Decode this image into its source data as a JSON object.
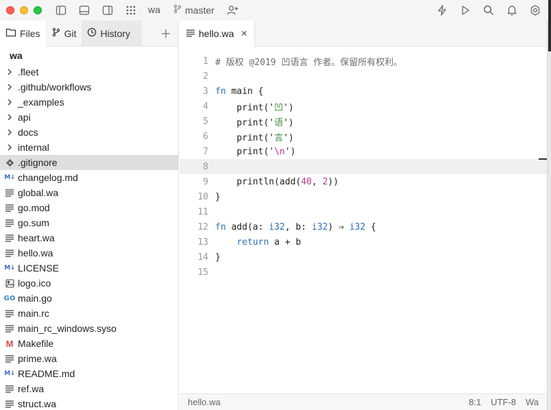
{
  "titlebar": {
    "project": "wa",
    "branch": "master"
  },
  "sidebar": {
    "tabs": [
      {
        "label": "Files"
      },
      {
        "label": "Git"
      },
      {
        "label": "History"
      }
    ],
    "root": "wa",
    "items": [
      {
        "label": ".fleet",
        "kind": "folder"
      },
      {
        "label": ".github/workflows",
        "kind": "folder"
      },
      {
        "label": "_examples",
        "kind": "folder"
      },
      {
        "label": "api",
        "kind": "folder"
      },
      {
        "label": "docs",
        "kind": "folder"
      },
      {
        "label": "internal",
        "kind": "folder"
      },
      {
        "label": ".gitignore",
        "kind": "git",
        "selected": true
      },
      {
        "label": "changelog.md",
        "kind": "md"
      },
      {
        "label": "global.wa",
        "kind": "text"
      },
      {
        "label": "go.mod",
        "kind": "text"
      },
      {
        "label": "go.sum",
        "kind": "text"
      },
      {
        "label": "heart.wa",
        "kind": "text"
      },
      {
        "label": "hello.wa",
        "kind": "text"
      },
      {
        "label": "LICENSE",
        "kind": "md"
      },
      {
        "label": "logo.ico",
        "kind": "image"
      },
      {
        "label": "main.go",
        "kind": "go"
      },
      {
        "label": "main.rc",
        "kind": "text"
      },
      {
        "label": "main_rc_windows.syso",
        "kind": "text"
      },
      {
        "label": "Makefile",
        "kind": "make"
      },
      {
        "label": "prime.wa",
        "kind": "text"
      },
      {
        "label": "README.md",
        "kind": "md"
      },
      {
        "label": "ref.wa",
        "kind": "text"
      },
      {
        "label": "struct.wa",
        "kind": "text"
      }
    ],
    "icons": {
      "md": "M↓",
      "go": "GO",
      "make": "M"
    }
  },
  "editor": {
    "tab_label": "hello.wa",
    "current_line": 8,
    "lines": [
      {
        "n": "1"
      },
      {
        "n": "2"
      },
      {
        "n": "3"
      },
      {
        "n": "4"
      },
      {
        "n": "5"
      },
      {
        "n": "6"
      },
      {
        "n": "7"
      },
      {
        "n": "8"
      },
      {
        "n": "9"
      },
      {
        "n": "10"
      },
      {
        "n": "11"
      },
      {
        "n": "12"
      },
      {
        "n": "13"
      },
      {
        "n": "14"
      },
      {
        "n": "15"
      }
    ],
    "code": {
      "l1": "# 版权 @2019 凹语言 作者。保留所有权利。",
      "l3_kw": "fn",
      "l3_rest": " main {",
      "l4_a": "    print('",
      "l4_s": "凹",
      "l4_b": "')",
      "l5_a": "    print('",
      "l5_s": "语",
      "l5_b": "')",
      "l6_a": "    print('",
      "l6_s": "言",
      "l6_b": "')",
      "l7_a": "    print('",
      "l7_s": "\\n",
      "l7_b": "')",
      "l9_a": "    println(add(",
      "l9_n1": "40",
      "l9_c": ", ",
      "l9_n2": "2",
      "l9_b": "))",
      "l10": "}",
      "l12_kw": "fn",
      "l12_a": " add(a: ",
      "l12_t1": "i32",
      "l12_b": ", b: ",
      "l12_t2": "i32",
      "l12_c": ") ⇒ ",
      "l12_t3": "i32",
      "l12_d": " {",
      "l13_pre": "    ",
      "l13_kw": "return",
      "l13_rest": " a + b",
      "l14": "}"
    }
  },
  "statusbar": {
    "file": "hello.wa",
    "position": "8:1",
    "encoding": "UTF-8",
    "language": "Wa"
  },
  "colors": {
    "keyword": "#2f6fb8",
    "string": "#3f8f3f",
    "number": "#b8388f",
    "selection": "#dedede"
  }
}
